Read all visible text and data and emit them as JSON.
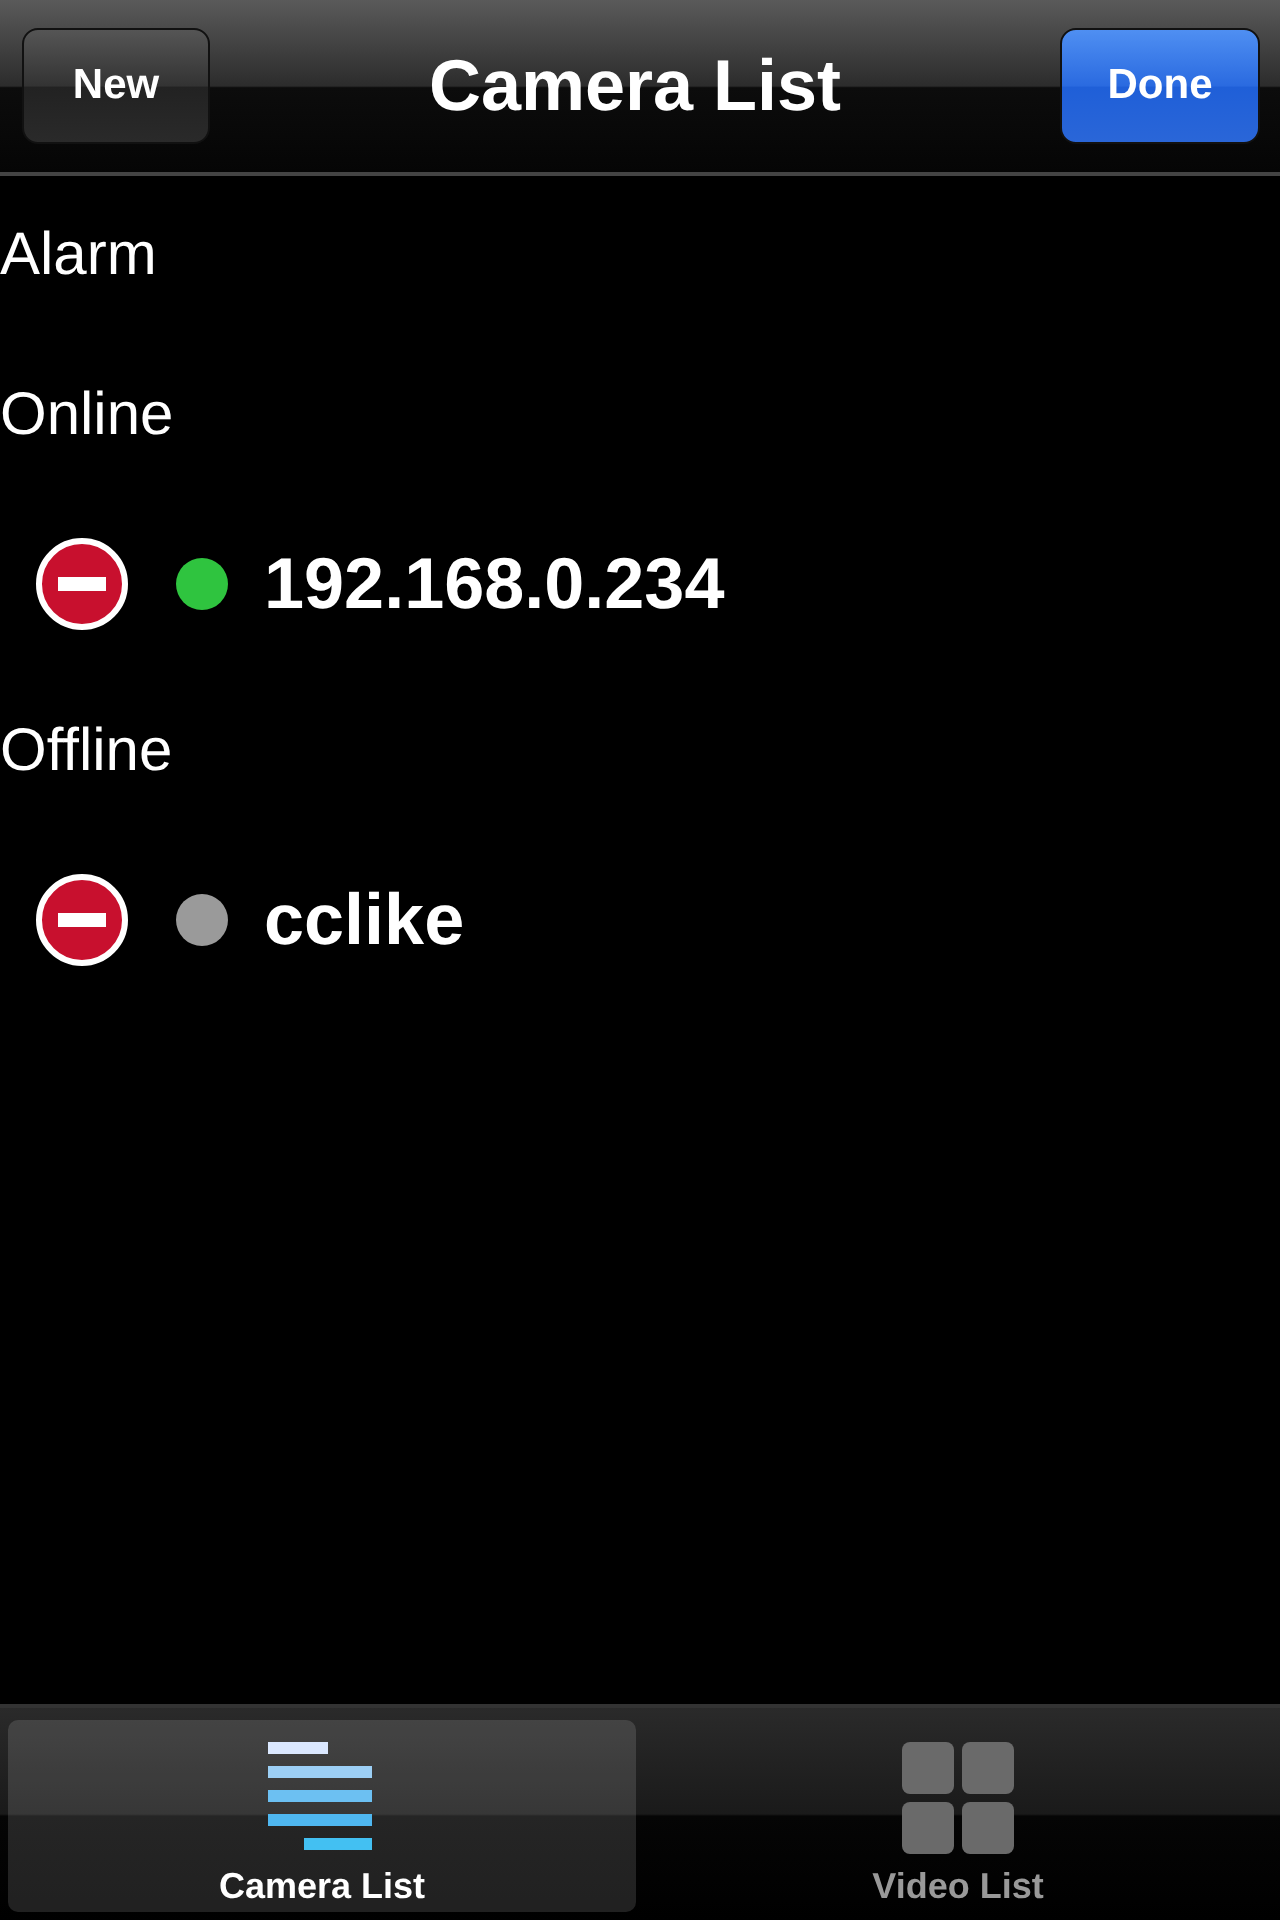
{
  "nav_bar": {
    "title": "Camera List",
    "left_button": "New",
    "right_button": "Done"
  },
  "sections": [
    {
      "title": "Alarm"
    },
    {
      "title": "Online",
      "cameras": [
        {
          "name": "192.168.0.234",
          "color": "#2fc43f"
        }
      ]
    },
    {
      "title": "Offline",
      "cameras": [
        {
          "name": "cclike",
          "color": "#9a9a9a"
        }
      ]
    }
  ],
  "tab_bar": [
    {
      "label": "Camera List",
      "kind": "list",
      "selected": true
    },
    {
      "label": "Video List",
      "kind": "grid",
      "selected": false
    }
  ]
}
